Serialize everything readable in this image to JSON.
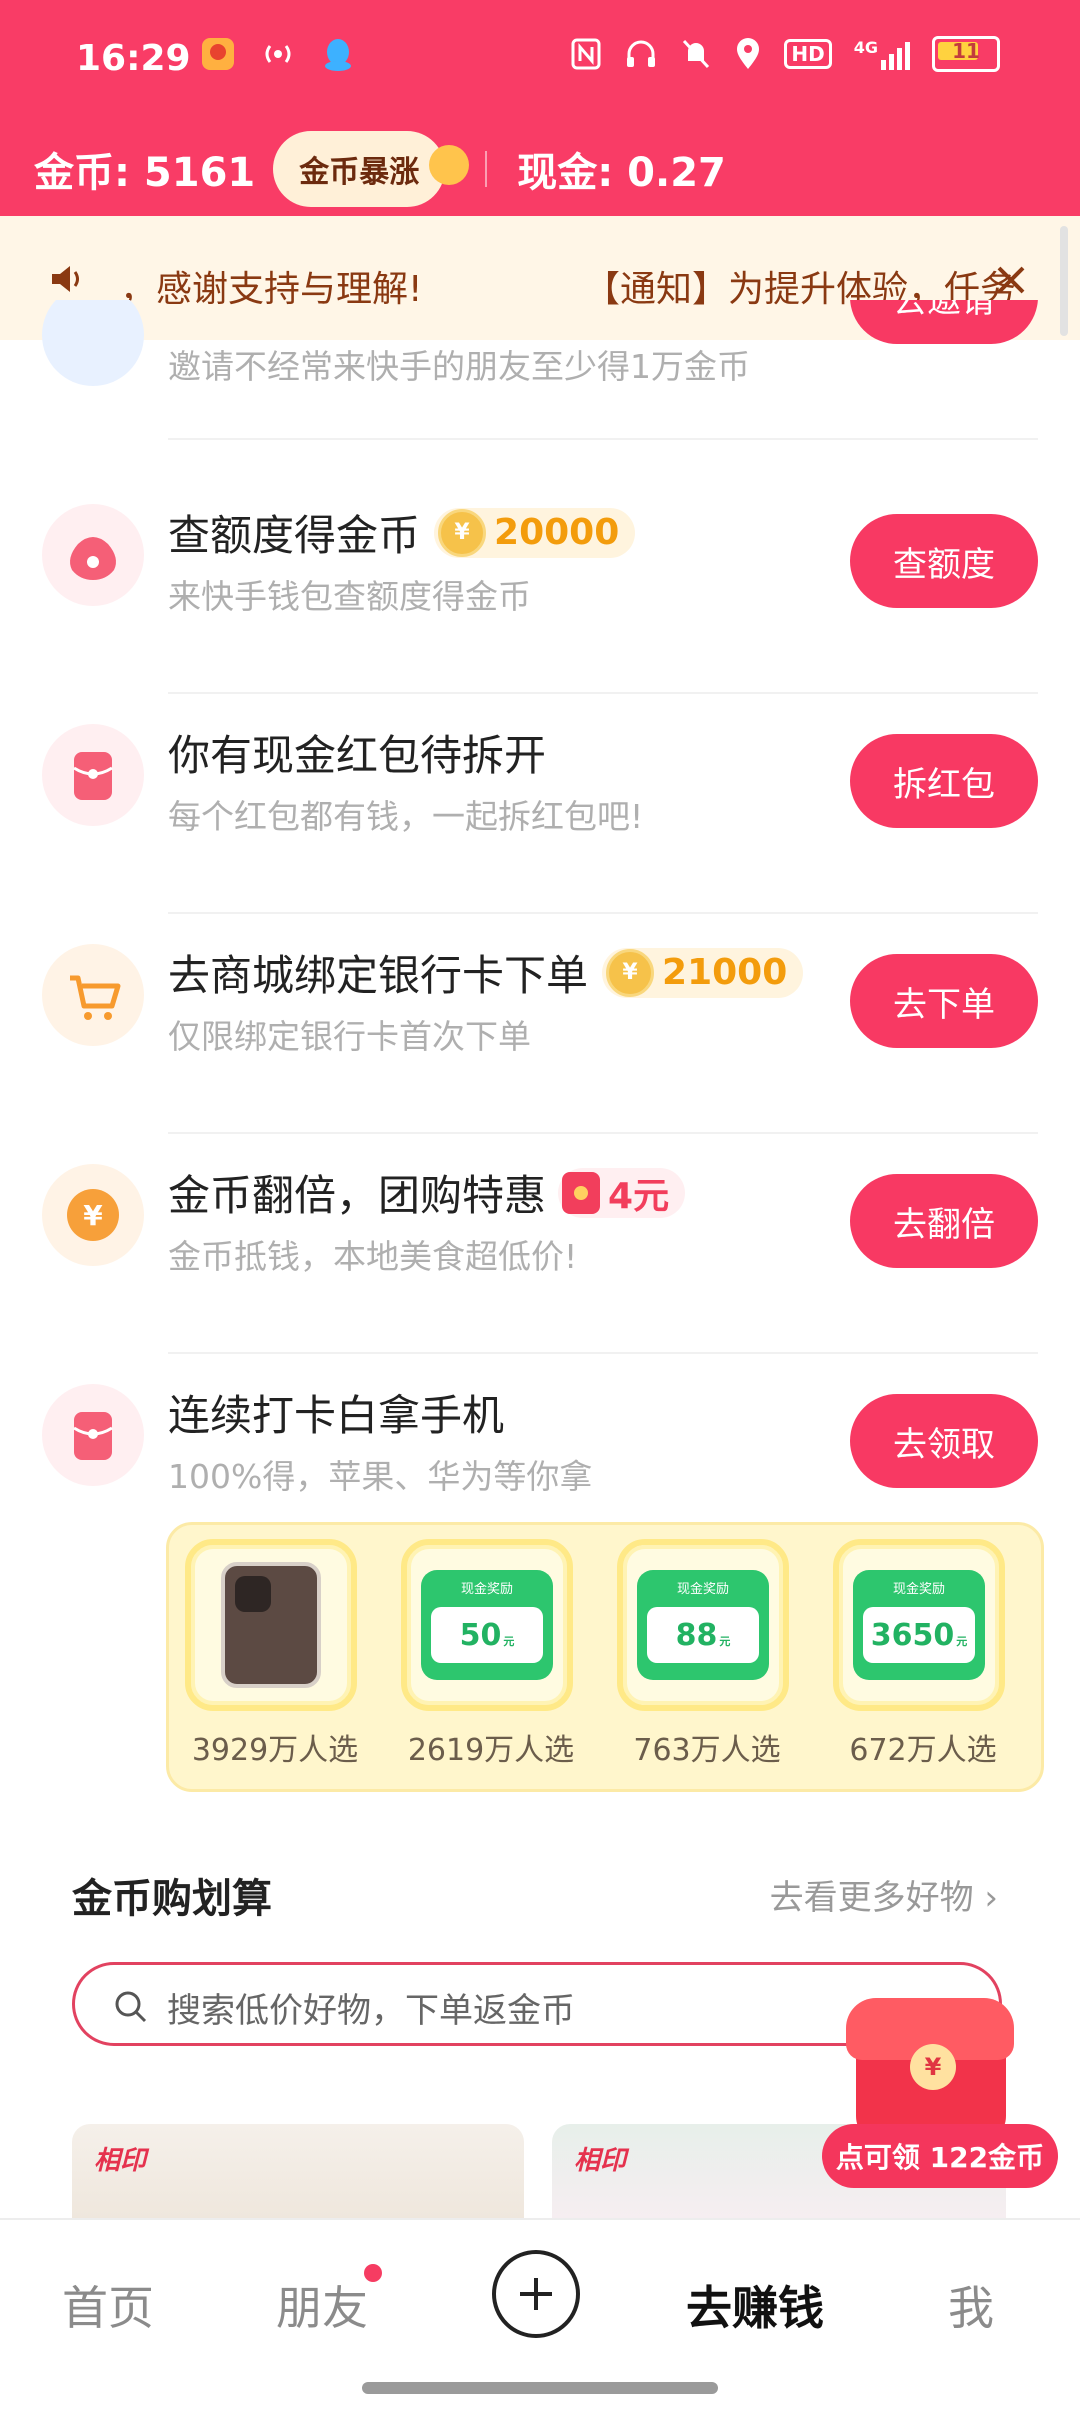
{
  "status_bar": {
    "time": "16:29",
    "battery": "11",
    "network": "4G",
    "hd": "HD"
  },
  "header": {
    "coins_label": "金币: 5161",
    "boost_label": "金币暴涨",
    "cash_label": "现金: 0.27"
  },
  "notice": {
    "text_left": "，感谢支持与理解!",
    "text_right": "【通知】为提升体验，任务"
  },
  "tasks": [
    {
      "title": "",
      "subtitle": "邀请不经常来快手的朋友至少得1万金币",
      "button": "去邀请",
      "icon": "friend-icon",
      "reward": ""
    },
    {
      "title": "查额度得金币",
      "subtitle": "来快手钱包查额度得金币",
      "button": "查额度",
      "icon": "money-bag-icon",
      "reward": "20000"
    },
    {
      "title": "你有现金红包待拆开",
      "subtitle": "每个红包都有钱，一起拆红包吧!",
      "button": "拆红包",
      "icon": "red-envelope-icon",
      "reward": ""
    },
    {
      "title": "去商城绑定银行卡下单",
      "subtitle": "仅限绑定银行卡首次下单",
      "button": "去下单",
      "icon": "cart-icon",
      "reward": "21000"
    },
    {
      "title": "金币翻倍，团购特惠",
      "subtitle": "金币抵钱，本地美食超低价!",
      "button": "去翻倍",
      "icon": "yuan-coin-icon",
      "reward": "4元"
    },
    {
      "title": "连续打卡白拿手机",
      "subtitle": "100%得，苹果、华为等你拿",
      "button": "去领取",
      "icon": "red-envelope-icon",
      "reward": ""
    }
  ],
  "prizes": [
    {
      "type": "phone",
      "count": "3929万人选"
    },
    {
      "type": "cash",
      "label": "现金奖励",
      "value": "50",
      "unit": "元",
      "count": "2619万人选"
    },
    {
      "type": "cash",
      "label": "现金奖励",
      "value": "88",
      "unit": "元",
      "count": "763万人选"
    },
    {
      "type": "cash",
      "label": "现金奖励",
      "value": "3650",
      "unit": "元",
      "count": "672万人选"
    }
  ],
  "shop": {
    "title": "金币购划算",
    "more": "去看更多好物 ›",
    "search_placeholder": "搜索低价好物，下单返金币",
    "brand": "相印"
  },
  "floating": {
    "claim": "点可领 122金币"
  },
  "nav": {
    "home": "首页",
    "friends": "朋友",
    "earn": "去赚钱",
    "me": "我"
  },
  "colors": {
    "primary": "#F93C66",
    "button": "#F83963",
    "notice_bg": "#FFF6E7",
    "gold": "#F39C0C"
  }
}
